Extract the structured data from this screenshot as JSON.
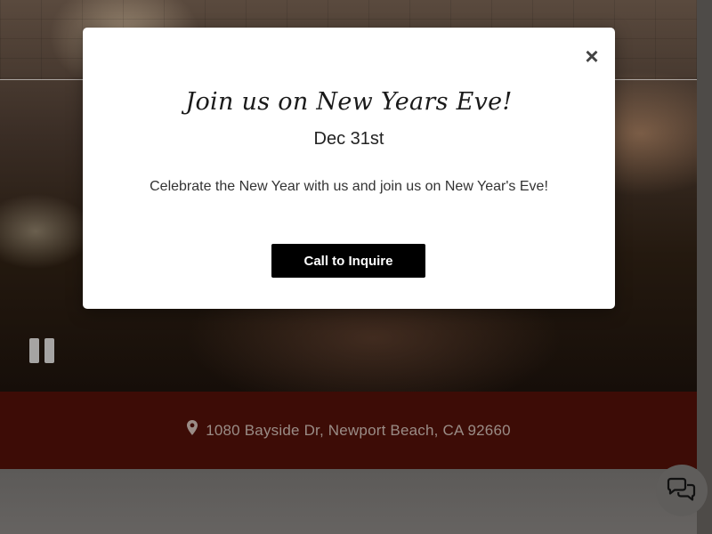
{
  "modal": {
    "title": "Join us on New Years Eve!",
    "date": "Dec 31st",
    "description": "Celebrate the New Year with us and join us on New Year's Eve!",
    "cta_label": "Call to Inquire",
    "close_glyph": "×"
  },
  "address": {
    "icon": "map-pin-icon",
    "text": "1080 Bayside Dr, Newport Beach, CA 92660"
  },
  "controls": {
    "pause_icon": "pause-icon",
    "chat_icon": "chat-bubbles-icon"
  },
  "colors": {
    "address_bar_bg": "#3d0c06",
    "cta_bg": "#000000",
    "modal_bg": "#ffffff"
  }
}
